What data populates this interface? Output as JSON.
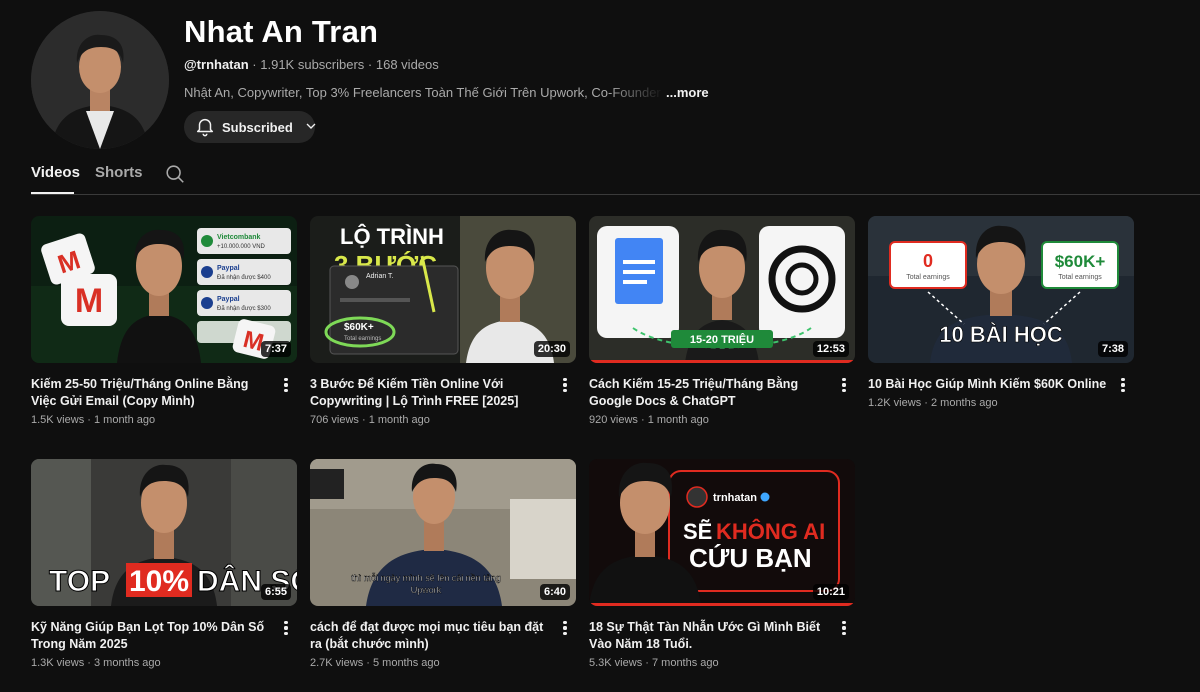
{
  "channel": {
    "name": "Nhat An Tran",
    "handle": "@trnhatan",
    "subscribers": "1.91K subscribers",
    "video_count": "168 videos",
    "separator": " · ",
    "description": "Nhật An, Copywriter, Top 3% Freelancers Toàn Thế Giới Trên Upwork, Co-Founder @Stud",
    "more_label": "...more",
    "subscribe_label": "Subscribed"
  },
  "tabs": [
    {
      "label": "Videos",
      "active": true
    },
    {
      "label": "Shorts",
      "active": false
    }
  ],
  "videos": [
    {
      "title": "Kiếm 25-50 Triệu/Tháng Online Bằng Việc Gửi Email (Copy Mình)",
      "views": "1.5K views",
      "age": "1 month ago",
      "duration": "7:37",
      "thumb_text": [
        "Vietcombank",
        "+10.000.000 VND",
        "Paypal",
        "Đã nhận được $400",
        "Paypal",
        "Đã nhận được $300"
      ]
    },
    {
      "title": "3 Bước Để Kiếm Tiền Online Với Copywriting | Lộ Trình FREE [2025]",
      "views": "706 views",
      "age": "1 month ago",
      "duration": "20:30",
      "thumb_text": [
        "LỘ TRÌNH",
        "3 BƯỚC",
        "Adrian T.",
        "$60K+",
        "Total earnings"
      ]
    },
    {
      "title": "Cách Kiếm 15-25 Triệu/Tháng Bằng Google Docs & ChatGPT",
      "views": "920 views",
      "age": "1 month ago",
      "duration": "12:53",
      "thumb_text": [
        "15-20 TRIỆU"
      ]
    },
    {
      "title": "10 Bài Học Giúp Mình Kiếm $60K Online",
      "views": "1.2K views",
      "age": "2 months ago",
      "duration": "7:38",
      "thumb_text": [
        "0",
        "Total earnings",
        "$60K+",
        "Total earnings",
        "10 BÀI HỌC"
      ]
    },
    {
      "title": "Kỹ Năng Giúp Bạn Lọt Top 10% Dân Số Trong Năm 2025",
      "views": "1.3K views",
      "age": "3 months ago",
      "duration": "6:55",
      "thumb_text": [
        "TOP",
        "10%",
        "DÂN SỐ"
      ]
    },
    {
      "title": "cách để đạt được mọi mục tiêu bạn đặt ra (bắt chước mình)",
      "views": "2.7K views",
      "age": "5 months ago",
      "duration": "6:40",
      "thumb_text": [
        "thì mỗi ngày mình sẽ lên cái nền tảng",
        "Upwork"
      ]
    },
    {
      "title": "18 Sự Thật Tàn Nhẫn Ước Gì Mình Biết Vào Năm 18 Tuổi.",
      "views": "5.3K views",
      "age": "7 months ago",
      "duration": "10:21",
      "thumb_text": [
        "trnhatan",
        "SẼ",
        "KHÔNG AI",
        "CỨU BẠN"
      ]
    }
  ],
  "colors": {
    "background": "#0f0f0f",
    "text_primary": "#f1f1f1",
    "text_secondary": "#aaaaaa",
    "button_bg": "#272727",
    "accent_red": "#e02b20",
    "accent_green": "#1f8a3a"
  },
  "icons": {
    "bell": "bell-icon",
    "chevron": "chevron-down-icon",
    "search": "search-icon",
    "menu": "more-vert-icon"
  }
}
